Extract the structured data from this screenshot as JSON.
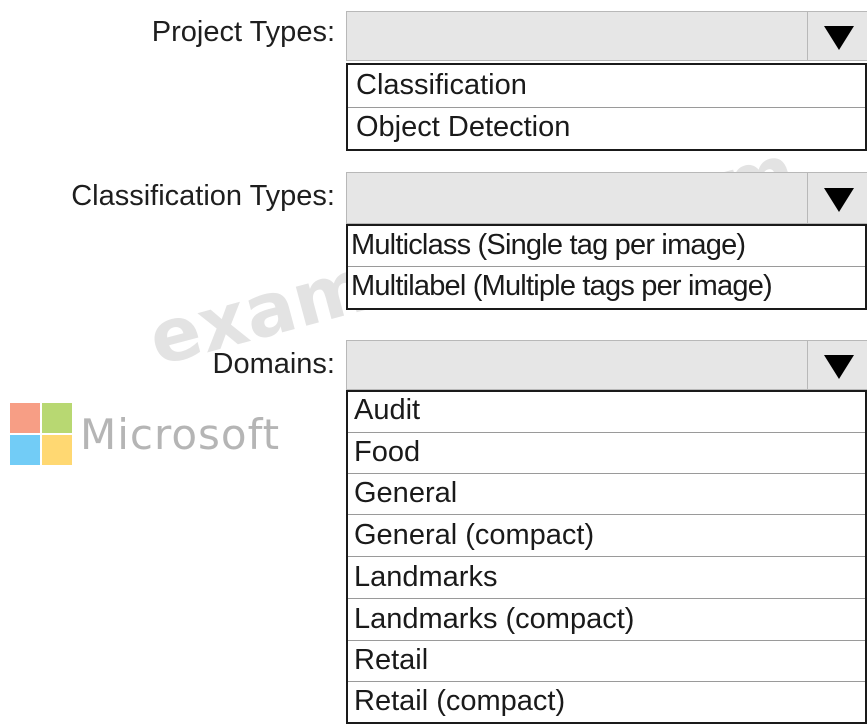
{
  "project_types": {
    "label": "Project Types:",
    "selected": "",
    "options": [
      "Classification",
      "Object Detection"
    ]
  },
  "classification_types": {
    "label": "Classification Types:",
    "selected": "",
    "options": [
      "Multiclass (Single tag per image)",
      "Multilabel (Multiple tags per image)"
    ]
  },
  "domains": {
    "label": "Domains:",
    "selected": "",
    "options": [
      "Audit",
      "Food",
      "General",
      "General (compact)",
      "Landmarks",
      "Landmarks (compact)",
      "Retail",
      "Retail (compact)"
    ]
  },
  "logo": {
    "wordmark": "Microsoft",
    "colors": [
      "#f25022",
      "#7fba00",
      "#00a4ef",
      "#ffb900"
    ]
  },
  "watermark": "exam-tests.com",
  "icons": {
    "dropdown": "triangle-down-icon"
  }
}
